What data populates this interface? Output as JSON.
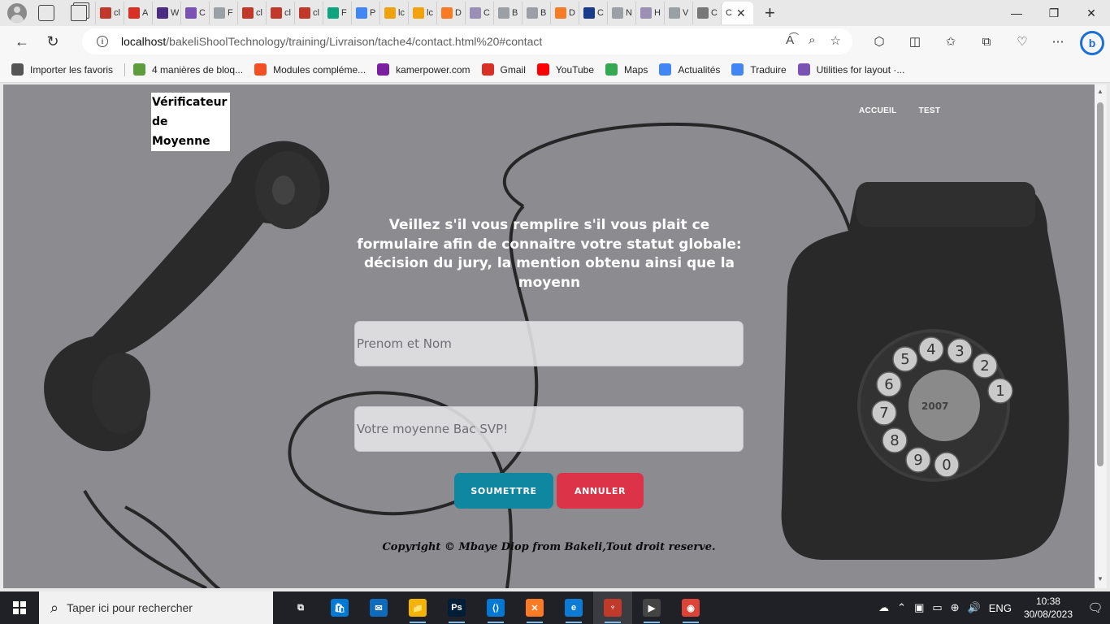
{
  "browser": {
    "tabs": [
      {
        "label": "cl",
        "icon": "pdf-icon",
        "color": "#c0392b"
      },
      {
        "label": "A",
        "icon": "gmail-icon",
        "color": "#d93025"
      },
      {
        "label": "W",
        "icon": "colorlib-icon",
        "color": "#4b2c82"
      },
      {
        "label": "C",
        "icon": "bootstrap-icon",
        "color": "#7952b3"
      },
      {
        "label": "F",
        "icon": "page-icon",
        "color": "#9aa0a6"
      },
      {
        "label": "cl",
        "icon": "pdf-icon",
        "color": "#c0392b"
      },
      {
        "label": "cl",
        "icon": "pdf-icon",
        "color": "#c0392b"
      },
      {
        "label": "cl",
        "icon": "pdf-icon",
        "color": "#c0392b"
      },
      {
        "label": "F",
        "icon": "chatgpt-icon",
        "color": "#10a37f"
      },
      {
        "label": "P",
        "icon": "google-icon",
        "color": "#4285f4"
      },
      {
        "label": "lc",
        "icon": "phpmyadmin-icon",
        "color": "#f0a30a"
      },
      {
        "label": "lc",
        "icon": "phpmyadmin-icon",
        "color": "#f0a30a"
      },
      {
        "label": "D",
        "icon": "xampp-icon",
        "color": "#fb7a24"
      },
      {
        "label": "C",
        "icon": "bootstrap-icon",
        "color": "#9b8fb5"
      },
      {
        "label": "B",
        "icon": "page-icon",
        "color": "#9aa0a6"
      },
      {
        "label": "B",
        "icon": "page-icon",
        "color": "#9aa0a6"
      },
      {
        "label": "D",
        "icon": "xampp-icon",
        "color": "#fb7a24"
      },
      {
        "label": "C",
        "icon": "w3-icon",
        "color": "#1a3a8a"
      },
      {
        "label": "N",
        "icon": "page-icon",
        "color": "#9aa0a6"
      },
      {
        "label": "H",
        "icon": "bootstrap-icon",
        "color": "#9b8fb5"
      },
      {
        "label": "V",
        "icon": "page-icon",
        "color": "#9aa0a6"
      },
      {
        "label": "C",
        "icon": "globe-icon",
        "color": "#777777"
      }
    ],
    "active_tab": {
      "label": "C",
      "close": "✕"
    },
    "new_tab": "+",
    "window_controls": {
      "minimize": "—",
      "restore": "❐",
      "close": "✕"
    },
    "url": {
      "host": "localhost",
      "path": "/bakeliShoolTechnology/training/Livraison/tache4/contact.html%20#contact"
    },
    "bookmarks": [
      {
        "label": "Importer les favoris",
        "color": "#555555"
      },
      {
        "label": "4 manières de bloq...",
        "color": "#5e9d3c"
      },
      {
        "label": "Modules compléme...",
        "color": "#f25022"
      },
      {
        "label": "kamerpower.com",
        "color": "#7a1fa2"
      },
      {
        "label": "Gmail",
        "color": "#d93025"
      },
      {
        "label": "YouTube",
        "color": "#ff0000"
      },
      {
        "label": "Maps",
        "color": "#34a853"
      },
      {
        "label": "Actualités",
        "color": "#4285f4"
      },
      {
        "label": "Traduire",
        "color": "#4285f4"
      },
      {
        "label": "Utilities for layout ·...",
        "color": "#7952b3"
      }
    ]
  },
  "page": {
    "brand": "Vérificateur de Moyenne",
    "nav": [
      "ACCUEIL",
      "TEST"
    ],
    "headline": "Veillez s'il vous remplire s'il vous plait ce formulaire afin de connaitre votre statut globale: décision du jury, la mention obtenu ainsi que la moyenn",
    "name_placeholder": "Prenom et Nom",
    "average_placeholder": "Votre moyenne Bac SVP!",
    "submit_label": "SOUMETTRE",
    "cancel_label": "ANNULER",
    "copyright": "Copyright © Mbaye Diop from Bakeli,Tout droit reserve.",
    "colors": {
      "submit": "#0f87a0",
      "cancel": "#dc3348",
      "overlay": "#8d8d90"
    }
  },
  "taskbar": {
    "search_placeholder": "Taper ici pour rechercher",
    "apps": [
      {
        "name": "task-view",
        "color": "#1f2126",
        "glyph": "⧉"
      },
      {
        "name": "store",
        "color": "#0078d4",
        "glyph": "🛍"
      },
      {
        "name": "mail",
        "color": "#0f6cbd",
        "glyph": "✉"
      },
      {
        "name": "file-explorer",
        "color": "#f4b400",
        "glyph": "📁"
      },
      {
        "name": "photoshop",
        "color": "#001e36",
        "glyph": "Ps"
      },
      {
        "name": "vscode",
        "color": "#0078d4",
        "glyph": "⟨⟩"
      },
      {
        "name": "xampp",
        "color": "#fb7a24",
        "glyph": "✕"
      },
      {
        "name": "edge",
        "color": "#0c7bd6",
        "glyph": "e"
      },
      {
        "name": "tool",
        "color": "#c0392b",
        "glyph": "♆"
      },
      {
        "name": "media-player",
        "color": "#444444",
        "glyph": "▶"
      },
      {
        "name": "chrome",
        "color": "#db4437",
        "glyph": "◉"
      }
    ],
    "language": "ENG",
    "time": "10:38",
    "date": "30/08/2023"
  }
}
